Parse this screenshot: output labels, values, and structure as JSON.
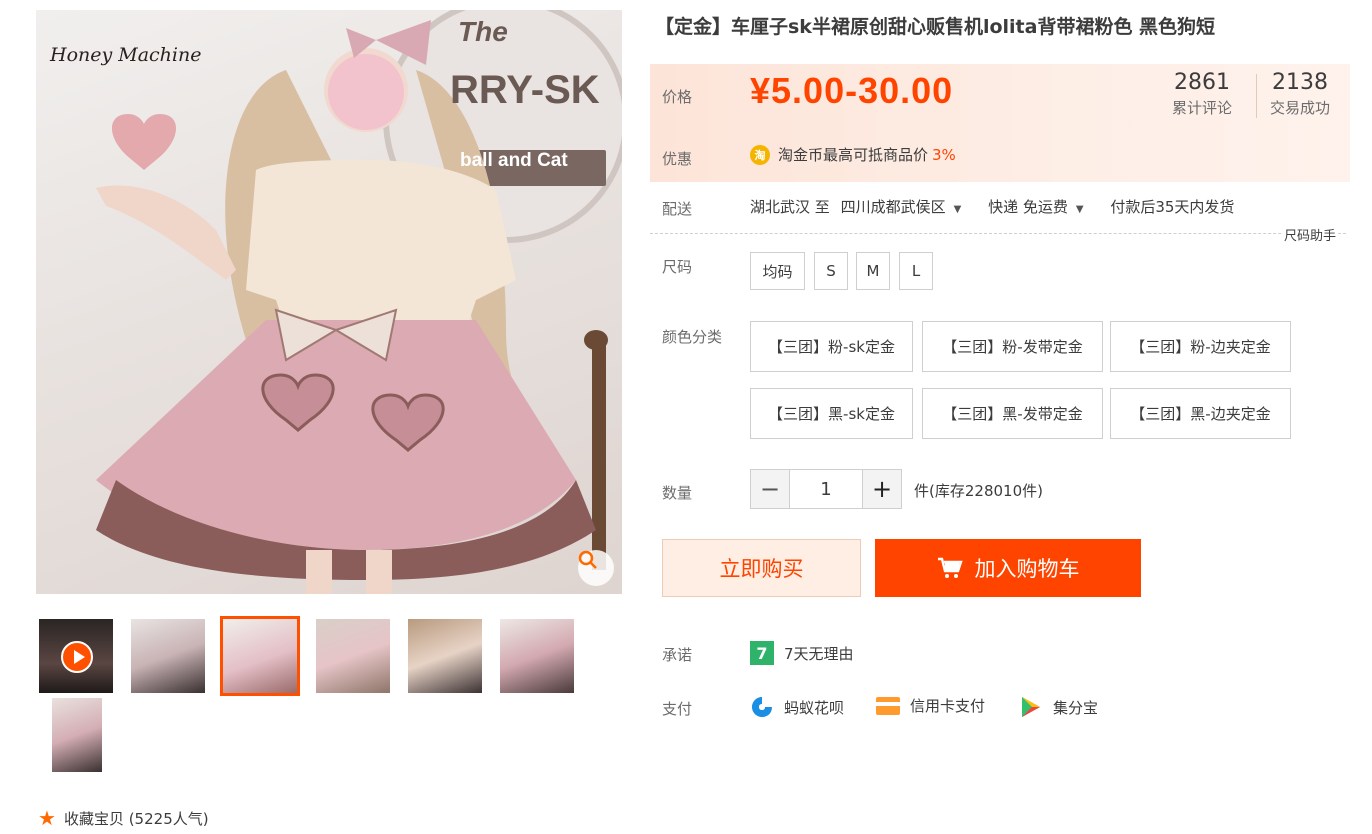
{
  "gallery": {
    "brand": "Honey Machine",
    "sign_top": "The",
    "sign_main": "RRY-SK",
    "sign_sub": "ball and Cat",
    "thumbnails": [
      "video",
      "photo-2",
      "photo-3",
      "photo-4",
      "photo-5",
      "photo-6",
      "photo-7"
    ],
    "active_thumbnail": 3
  },
  "favorite": {
    "icon": "star-icon",
    "label": "收藏宝贝 (5225人气)"
  },
  "product": {
    "title": "【定金】车厘子sk半裙原创甜心贩售机lolita背带裙粉色 黑色狗短",
    "price_label": "价格",
    "price": "¥5.00-30.00",
    "stats": [
      {
        "value": "2861",
        "caption": "累计评论"
      },
      {
        "value": "2138",
        "caption": "交易成功"
      }
    ],
    "promo_label": "优惠",
    "promo_text": "淘金币最高可抵商品价",
    "promo_pct": "3%"
  },
  "shipping": {
    "label": "配送",
    "from": "湖北武汉 至",
    "to": "四川成都武侯区",
    "method": "快递 免运费",
    "note": "付款后35天内发货",
    "size_help": "尺码助手"
  },
  "size": {
    "label": "尺码",
    "options": [
      "均码",
      "S",
      "M",
      "L"
    ]
  },
  "color": {
    "label": "颜色分类",
    "options": [
      "【三团】粉-sk定金",
      "【三团】粉-发带定金",
      "【三团】粉-边夹定金",
      "【三团】黑-sk定金",
      "【三团】黑-发带定金",
      "【三团】黑-边夹定金"
    ]
  },
  "quantity": {
    "label": "数量",
    "minus": "−",
    "value": "1",
    "plus": "+",
    "stock": "件(库存228010件)"
  },
  "actions": {
    "buy_now": "立即购买",
    "add_to_cart": "加入购物车"
  },
  "promise": {
    "label": "承诺",
    "badge": "7",
    "text": "7天无理由"
  },
  "payment": {
    "label": "支付",
    "methods": [
      "蚂蚁花呗",
      "信用卡支付",
      "集分宝"
    ]
  },
  "colors": {
    "accent": "#ff4400",
    "price_bg": "#fde4d8",
    "button_light_bg": "#ffeee4"
  }
}
